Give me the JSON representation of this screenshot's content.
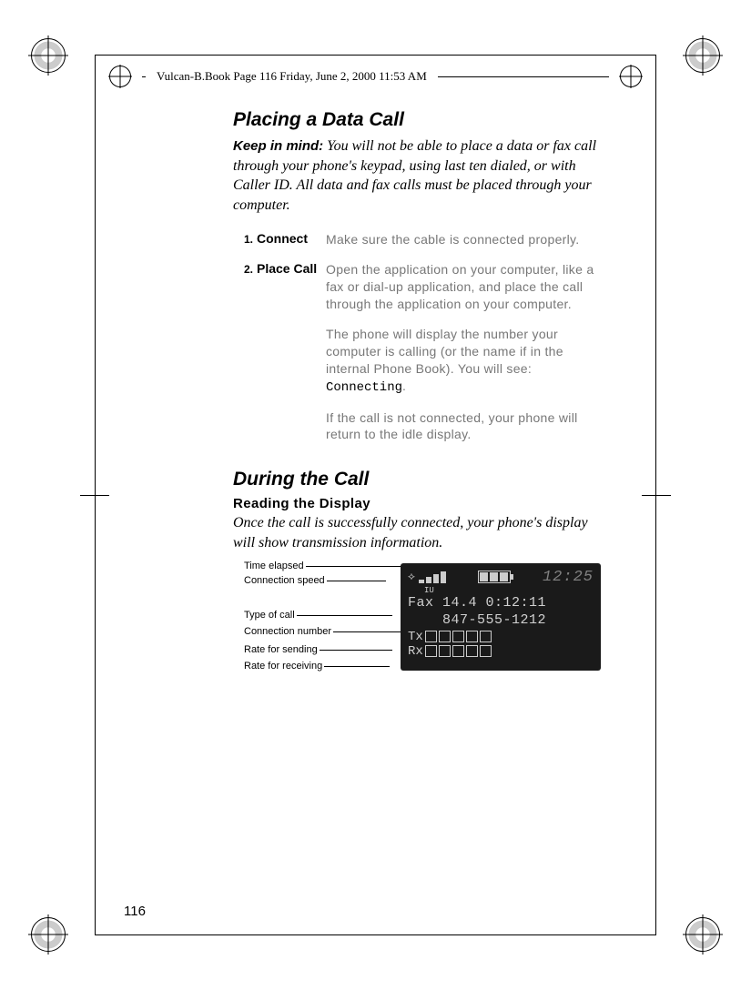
{
  "header_text": "Vulcan-B.Book  Page 116  Friday, June 2, 2000  11:53 AM",
  "section1_title": "Placing a Data Call",
  "keep_label": "Keep in mind:",
  "keep_text": " You will not be able to place a data or fax call through your phone's keypad, using last ten dialed, or with Caller ID. All data and fax calls must be placed through your computer.",
  "steps": {
    "s1": {
      "num": "1.",
      "label": "Connect",
      "desc": "Make sure the cable is connected properly."
    },
    "s2": {
      "num": "2.",
      "label": "Place Call",
      "p1": "Open the application on your computer, like a fax or dial-up application, and place the call through the application on your computer.",
      "p2a": "The phone will display the number your computer is calling (or the name if in the internal Phone Book). You will see: ",
      "p2b": "Connecting",
      "p2c": ".",
      "p3": "If the call is not connected, your phone will return to the idle display."
    }
  },
  "section2_title": "During the Call",
  "subhead": "Reading the Display",
  "intro2": "Once the call is successfully connected, your phone's display will show transmission information.",
  "labels": {
    "l1": "Time elapsed",
    "l2": "Connection speed",
    "l3": "Type of call",
    "l4": "Connection number",
    "l5": "Rate for sending",
    "l6": "Rate for receiving"
  },
  "lcd": {
    "clock": "12:25",
    "iu": "IU",
    "line1": "Fax 14.4 0:12:11",
    "line2": "    847-555-1212",
    "tx": "Tx",
    "rx": "Rx"
  },
  "page_number": "116"
}
